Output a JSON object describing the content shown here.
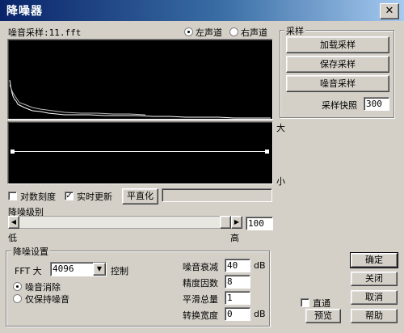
{
  "window": {
    "title": "降噪器",
    "close_glyph": "✕"
  },
  "sample_label": "噪音采样:11.fft",
  "channel": {
    "left": "左声道",
    "right": "右声道",
    "selected": "left"
  },
  "right_panel": {
    "group_title": "采样",
    "load_btn": "加载采样",
    "save_btn": "保存采样",
    "noise_btn": "噪音采样",
    "snapshot_label": "采样快照",
    "snapshot_value": "300"
  },
  "curve_labels": {
    "big": "大",
    "small": "小"
  },
  "options": {
    "log_scale": "对数刻度",
    "log_scale_checked": false,
    "realtime": "实时更新",
    "realtime_checked": true,
    "flatten_btn": "平直化"
  },
  "level": {
    "title": "降噪级别",
    "low": "低",
    "high": "高",
    "value": "100"
  },
  "settings": {
    "group_title": "降噪设置",
    "fft_label": "FFT 大",
    "fft_value": "4096",
    "control_label": "控制",
    "mode_remove": "噪音消除",
    "mode_keep": "仅保持噪音",
    "mode_selected": "remove",
    "decay_label": "噪音衰减",
    "decay_value": "40",
    "decay_unit": "dB",
    "precision_label": "精度因数",
    "precision_value": "8",
    "smooth_label": "平滑总量",
    "smooth_value": "1",
    "width_label": "转换宽度",
    "width_value": "0",
    "width_unit": "dB"
  },
  "bottom": {
    "bypass_label": "直通",
    "bypass_checked": false,
    "ok": "确定",
    "close": "关闭",
    "cancel": "取消",
    "help": "帮助",
    "preview": "预览"
  }
}
